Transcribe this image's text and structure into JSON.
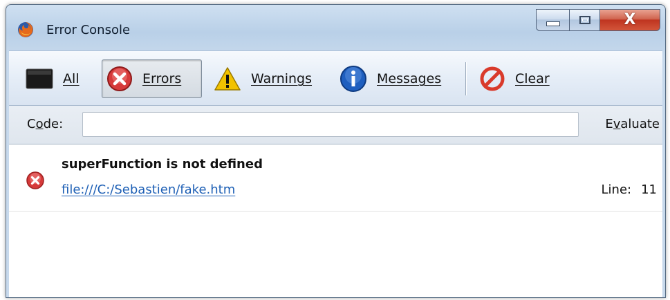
{
  "window": {
    "title": "Error Console",
    "close_glyph": "X"
  },
  "toolbar": {
    "buttons": [
      {
        "id": "all",
        "label": "All",
        "icon": "console-icon",
        "active": false
      },
      {
        "id": "errors",
        "label": "Errors",
        "icon": "error-icon",
        "active": true
      },
      {
        "id": "warnings",
        "label": "Warnings",
        "icon": "warning-icon",
        "active": false
      },
      {
        "id": "messages",
        "label": "Messages",
        "icon": "info-icon",
        "active": false
      },
      {
        "id": "clear",
        "label": "Clear",
        "icon": "clear-icon",
        "active": false
      }
    ]
  },
  "code_bar": {
    "label_pre": "C",
    "label_key": "o",
    "label_post": "de:",
    "input_value": "",
    "evaluate_pre": "E",
    "evaluate_key": "v",
    "evaluate_post": "aluate"
  },
  "entries": [
    {
      "message": "superFunction is not defined",
      "source": "file:///C:/Sebastien/fake.htm",
      "line_label": "Line:",
      "line_number": "11",
      "icon": "error-icon"
    }
  ],
  "colors": {
    "link": "#1d5fb5",
    "error_red": "#d63a3a",
    "warning_yellow": "#f2c200",
    "info_blue": "#1f5fbf",
    "clear_red": "#d93a2b"
  }
}
